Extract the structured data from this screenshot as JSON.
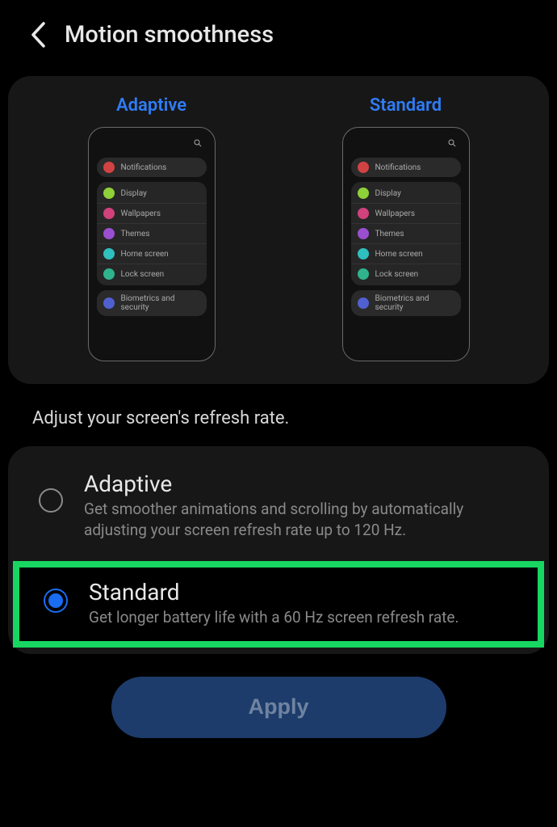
{
  "header": {
    "title": "Motion smoothness"
  },
  "preview": {
    "adaptive_label": "Adaptive",
    "standard_label": "Standard",
    "menu": {
      "notifications": "Notifications",
      "display": "Display",
      "wallpapers": "Wallpapers",
      "themes": "Themes",
      "home_screen": "Home screen",
      "lock_screen": "Lock screen",
      "biometrics": "Biometrics and security"
    },
    "icon_colors": {
      "notifications": "#d14343",
      "display": "#8fd138",
      "wallpapers": "#d1417b",
      "themes": "#9a4fd1",
      "home_screen": "#2fbfbf",
      "lock_screen": "#2fb38c",
      "biometrics": "#5060d1"
    }
  },
  "help_text": "Adjust your screen's refresh rate.",
  "options": {
    "adaptive": {
      "title": "Adaptive",
      "desc": "Get smoother animations and scrolling by automatically adjusting your screen refresh rate up to 120 Hz.",
      "selected": false
    },
    "standard": {
      "title": "Standard",
      "desc": "Get longer battery life with a 60 Hz screen refresh rate.",
      "selected": true
    }
  },
  "apply_label": "Apply"
}
